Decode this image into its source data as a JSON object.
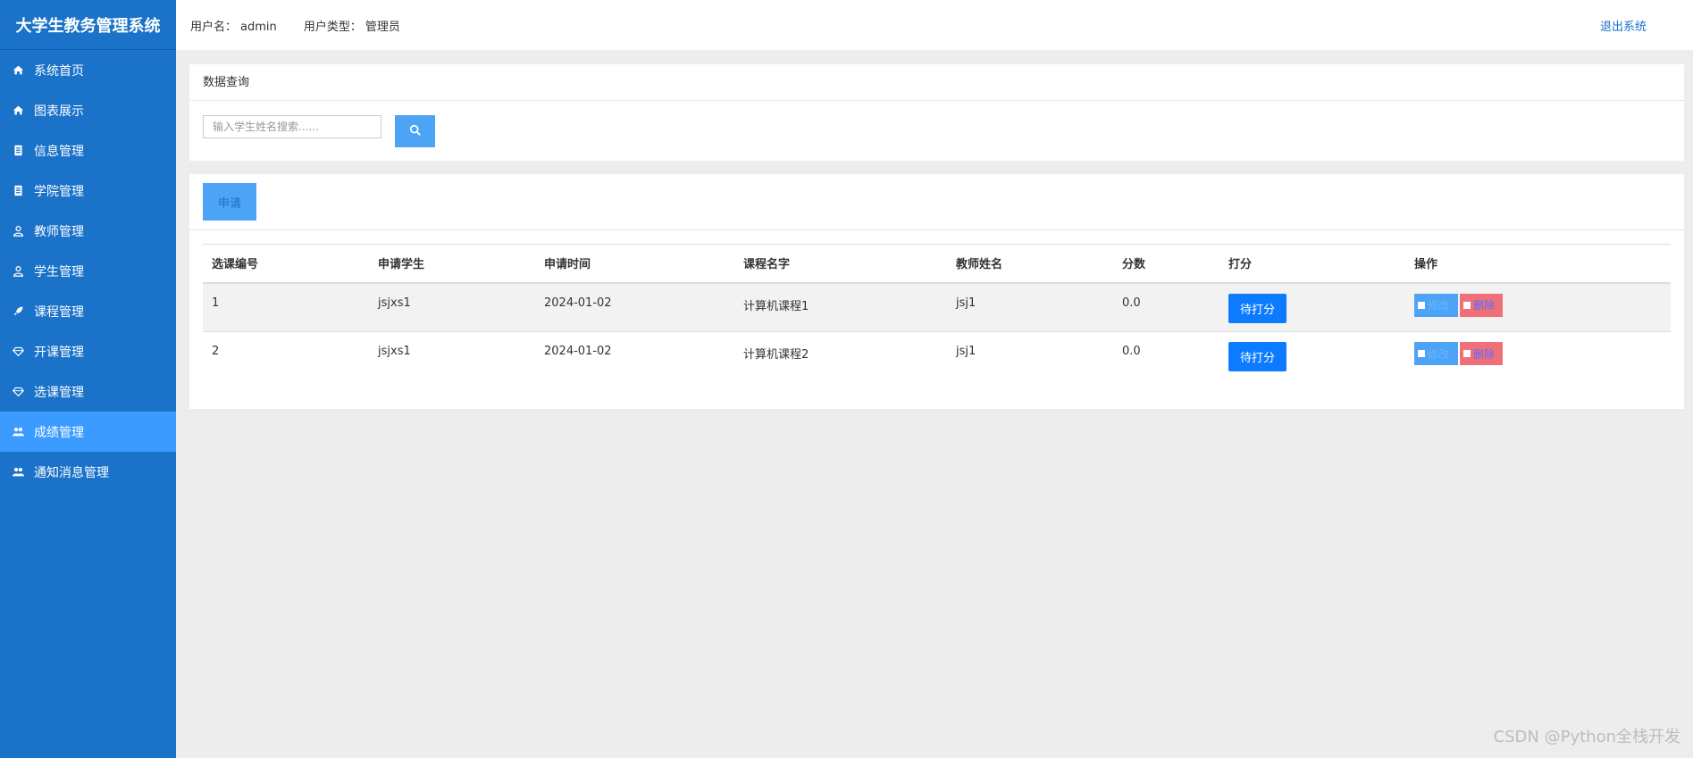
{
  "app": {
    "title": "大学生教务管理系统"
  },
  "header": {
    "username_label": "用户名：",
    "username": "admin",
    "usertype_label": "用户类型：",
    "usertype": "管理员",
    "logout": "退出系统"
  },
  "sidebar": {
    "items": [
      {
        "label": "系统首页",
        "icon": "home-icon"
      },
      {
        "label": "图表展示",
        "icon": "home-icon"
      },
      {
        "label": "信息管理",
        "icon": "document-icon"
      },
      {
        "label": "学院管理",
        "icon": "document-icon"
      },
      {
        "label": "教师管理",
        "icon": "user-icon"
      },
      {
        "label": "学生管理",
        "icon": "user-icon"
      },
      {
        "label": "课程管理",
        "icon": "rocket-icon"
      },
      {
        "label": "开课管理",
        "icon": "diamond-icon"
      },
      {
        "label": "选课管理",
        "icon": "diamond-icon"
      },
      {
        "label": "成绩管理",
        "icon": "users-icon",
        "active": true
      },
      {
        "label": "通知消息管理",
        "icon": "users-icon"
      }
    ]
  },
  "search": {
    "title": "数据查询",
    "placeholder": "输入学生姓名搜索......"
  },
  "toolbar": {
    "apply_label": "申请"
  },
  "table": {
    "columns": [
      "选课编号",
      "申请学生",
      "申请时间",
      "课程名字",
      "教师姓名",
      "分数",
      "打分",
      "操作"
    ],
    "rows": [
      {
        "id": "1",
        "student": "jsjxs1",
        "date": "2024-01-02",
        "course": "计算机课程1",
        "teacher": "jsj1",
        "score": "0.0",
        "grade_btn": "待打分",
        "edit": "修改",
        "delete": "删除"
      },
      {
        "id": "2",
        "student": "jsjxs1",
        "date": "2024-01-02",
        "course": "计算机课程2",
        "teacher": "jsj1",
        "score": "0.0",
        "grade_btn": "待打分",
        "edit": "修改",
        "delete": "删除"
      }
    ]
  },
  "watermark": "CSDN @Python全栈开发",
  "colors": {
    "sidebar": "#1a72c9",
    "active": "#3c9bff",
    "primary": "#0d7bff",
    "danger": "#f0707a"
  }
}
